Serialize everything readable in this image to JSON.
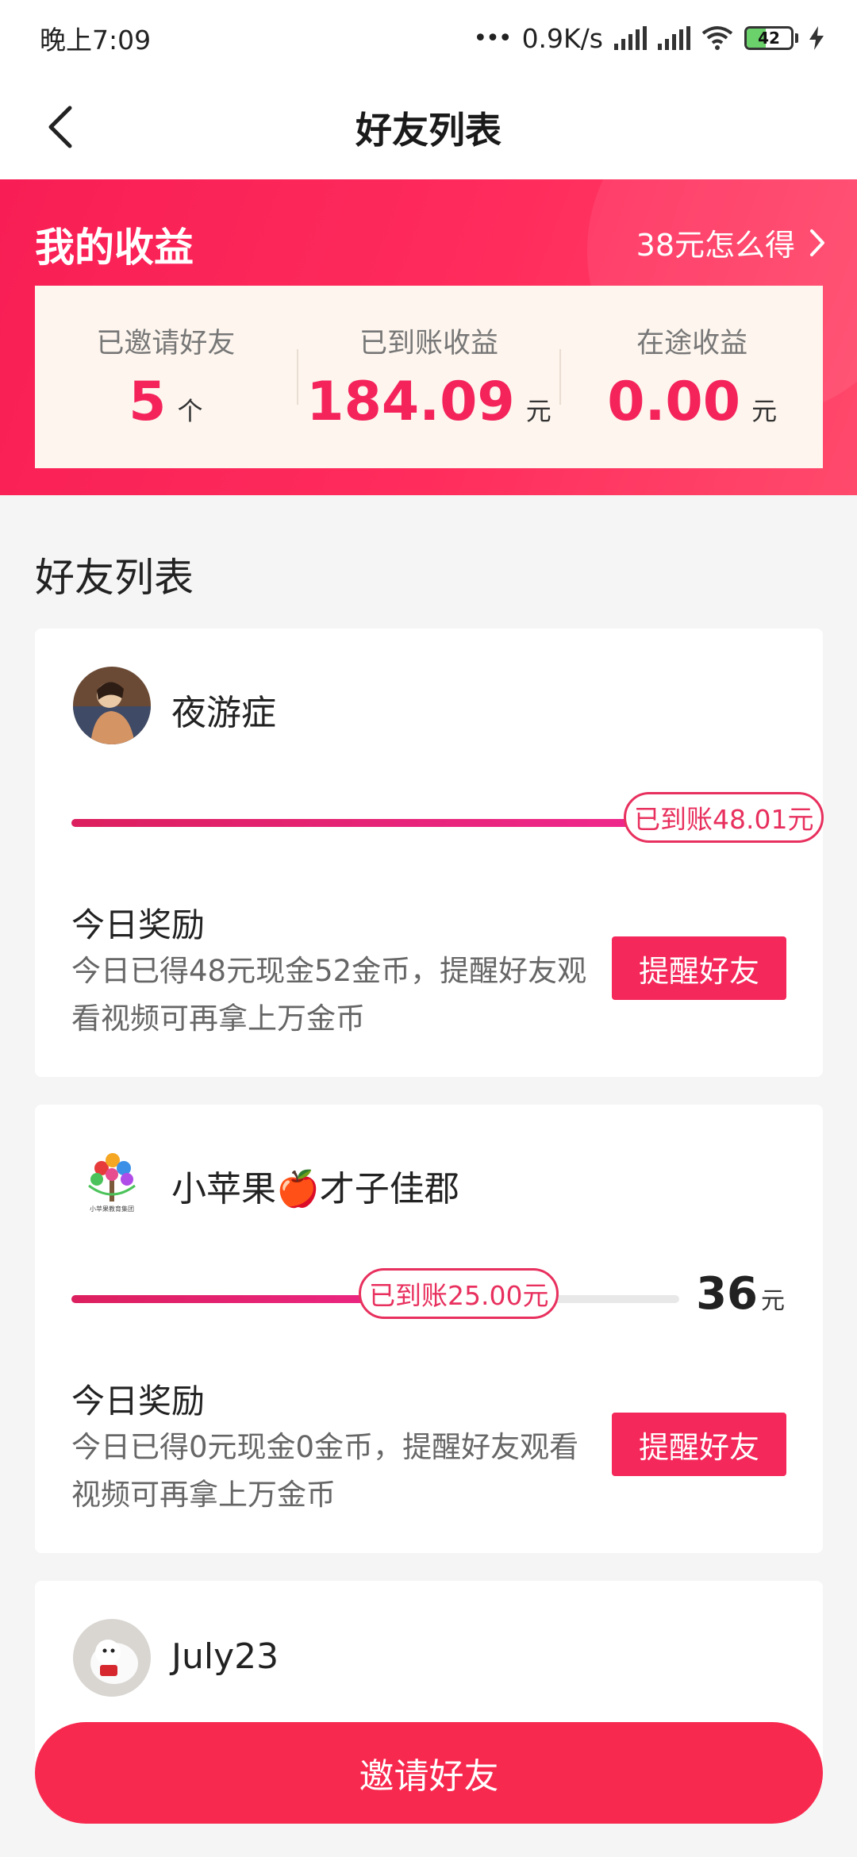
{
  "status_bar": {
    "time": "晚上7:09",
    "network_speed": "0.9K/s",
    "battery": "42"
  },
  "nav": {
    "title": "好友列表"
  },
  "earnings": {
    "title": "我的收益",
    "link": "38元怎么得",
    "stats": [
      {
        "label": "已邀请好友",
        "value": "5",
        "unit": "个"
      },
      {
        "label": "已到账收益",
        "value": "184.09",
        "unit": "元"
      },
      {
        "label": "在途收益",
        "value": "0.00",
        "unit": "元"
      }
    ]
  },
  "friends_section": {
    "title": "好友列表"
  },
  "friends": [
    {
      "name": "夜游症",
      "progress_label": "已到账48.01元",
      "progress_fraction": 1.0,
      "target_value": "",
      "target_unit": "",
      "reward_title": "今日奖励",
      "reward_desc": "今日已得48元现金52金币，提醒好友观看视频可再拿上万金币",
      "remind_label": "提醒好友"
    },
    {
      "name": "小苹果🍎才子佳郡",
      "progress_label": "已到账25.00元",
      "progress_fraction": 0.69,
      "target_value": "36",
      "target_unit": "元",
      "reward_title": "今日奖励",
      "reward_desc": "今日已得0元现金0金币，提醒好友观看视频可再拿上万金币",
      "remind_label": "提醒好友",
      "avatar_logo_text": "小苹果教育集团"
    },
    {
      "name": "July23"
    }
  ],
  "invite_button": {
    "label": "邀请好友"
  },
  "colors": {
    "accent": "#f4285a",
    "banner": "#ff2c5c",
    "panel": "#fdf5ee"
  }
}
